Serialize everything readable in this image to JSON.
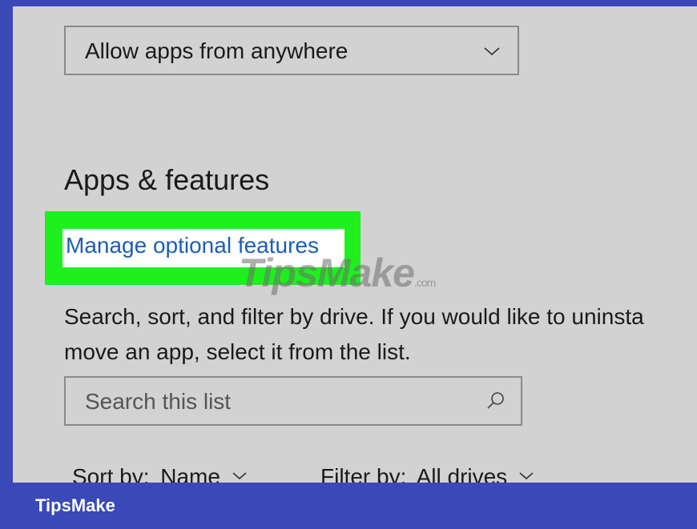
{
  "dropdown": {
    "value": "Allow apps from anywhere",
    "icon": "chevron-down-icon"
  },
  "section": {
    "title": "Apps & features"
  },
  "link": {
    "label": "Manage optional features"
  },
  "watermark": {
    "text": "TipsMake",
    "suffix": ".com"
  },
  "description": {
    "line1": "Search, sort, and filter by drive. If you would like to uninsta",
    "line2": "move an app, select it from the list."
  },
  "search": {
    "placeholder": "Search this list",
    "icon": "search-icon"
  },
  "sort": {
    "label": "Sort by:",
    "value": "Name"
  },
  "filter": {
    "label": "Filter by:",
    "value": "All drives"
  },
  "footer": {
    "brand": "TipsMake"
  },
  "colors": {
    "highlight": "#1ef01e",
    "link": "#1a5fb4",
    "frame": "#3a48b8",
    "background": "#d2d2d2"
  }
}
